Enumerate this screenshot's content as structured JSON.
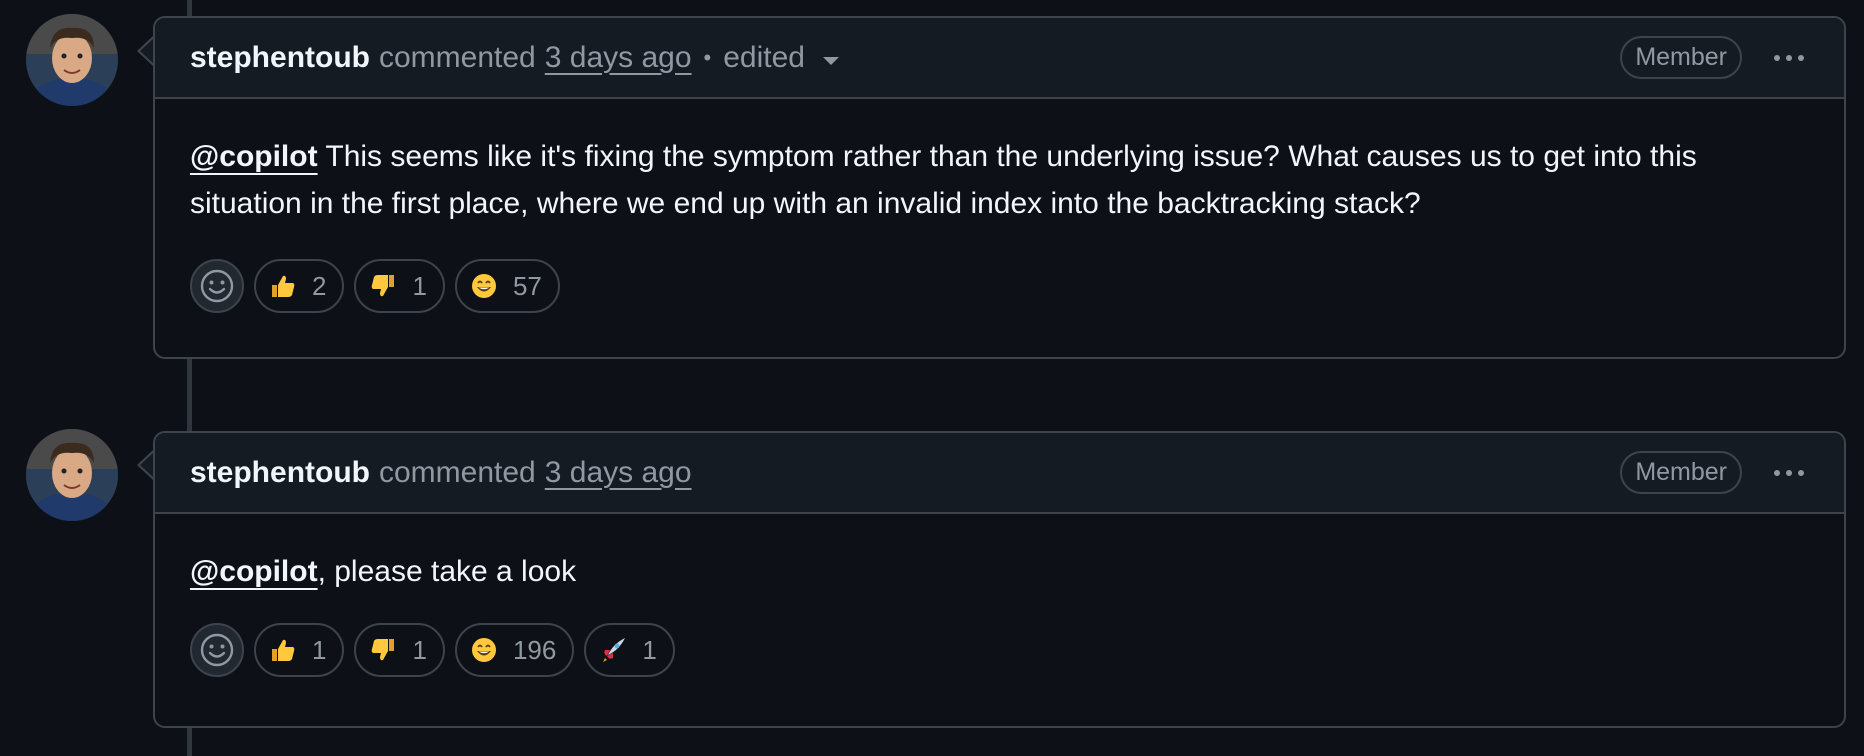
{
  "comments": [
    {
      "author": "stephentoub",
      "action": "commented",
      "time": "3 days ago",
      "edited": true,
      "edited_label": "edited",
      "separator": "•",
      "badge": "Member",
      "mention": "@copilot",
      "text": " This seems like it's fixing the symptom rather than the underlying issue? What causes us to get into this situation in the first place, where we end up with an invalid index into the backtracking stack?",
      "reactions": [
        {
          "emoji": "thumbs-up",
          "count": "2"
        },
        {
          "emoji": "thumbs-down",
          "count": "1"
        },
        {
          "emoji": "grinning-face",
          "count": "57"
        }
      ]
    },
    {
      "author": "stephentoub",
      "action": "commented",
      "time": "3 days ago",
      "edited": false,
      "badge": "Member",
      "mention": "@copilot",
      "text": ", please take a look",
      "reactions": [
        {
          "emoji": "thumbs-up",
          "count": "1"
        },
        {
          "emoji": "thumbs-down",
          "count": "1"
        },
        {
          "emoji": "grinning-face",
          "count": "196"
        },
        {
          "emoji": "rocket",
          "count": "1"
        }
      ]
    }
  ],
  "colors": {
    "background": "#0d1117",
    "header_bg": "#151b23",
    "border": "#3d444d",
    "text_primary": "#f0f6fc",
    "text_muted": "#9198a1"
  }
}
